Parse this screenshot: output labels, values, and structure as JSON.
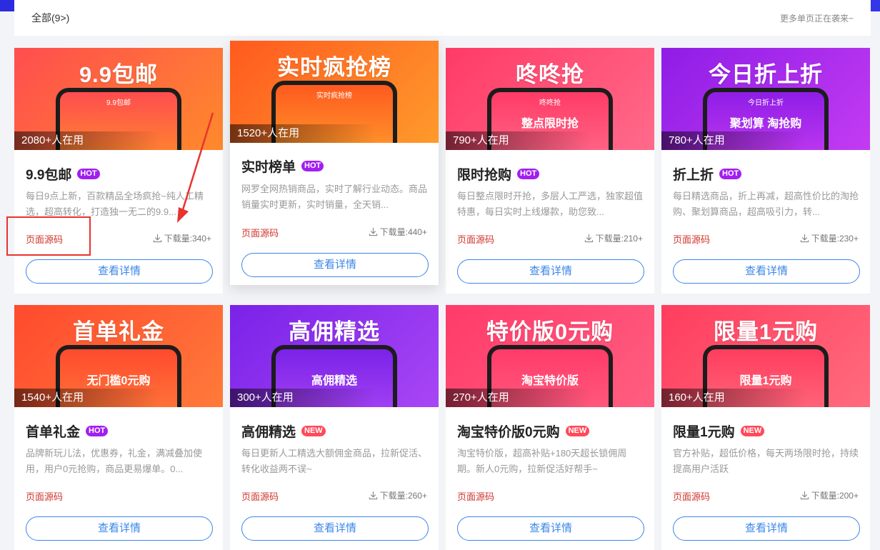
{
  "header": {
    "all_label": "全部(9>)",
    "more_label": "更多单页正在袭来~"
  },
  "common": {
    "source_label": "页面源码",
    "detail_label": "查看详情"
  },
  "cards": [
    {
      "banner_title": "9.9包邮",
      "phone_label": "9.9包邮",
      "phone_promo": "",
      "users": "2080+人在用",
      "title": "9.9包邮",
      "tag": "HOT",
      "desc": "每日9点上新，百款精品全场疯抢~纯人工精选，超高转化，打造独一无二的9.9...",
      "downloads": "下载量:340+",
      "bg": [
        "#ff4d4f",
        "#ff8a2b"
      ]
    },
    {
      "banner_title": "实时疯抢榜",
      "phone_label": "实时疯抢榜",
      "phone_promo": "",
      "users": "1520+人在用",
      "title": "实时榜单",
      "tag": "HOT",
      "desc": "网罗全网热销商品，实时了解行业动态。商品销量实时更新，实时销量，全天销...",
      "downloads": "下载量:440+",
      "bg": [
        "#ff5a1f",
        "#ff9a2b"
      ]
    },
    {
      "banner_title": "咚咚抢",
      "phone_label": "咚咚抢",
      "phone_promo": "整点限时抢",
      "users": "790+人在用",
      "title": "限时抢购",
      "tag": "HOT",
      "desc": "每日整点限时开抢，多层人工严选，独家超值特惠，每日实时上线爆款，助您致...",
      "downloads": "下载量:210+",
      "bg": [
        "#ff3b66",
        "#ff6a8a"
      ]
    },
    {
      "banner_title": "今日折上折",
      "phone_label": "今日折上折",
      "phone_promo": "聚划算 淘抢购",
      "users": "780+人在用",
      "title": "折上折",
      "tag": "HOT",
      "desc": "每日精选商品，折上再减，超高性价比的淘抢购、聚划算商品，超高吸引力，转...",
      "downloads": "下载量:230+",
      "bg": [
        "#8f1de6",
        "#c33bf2"
      ]
    },
    {
      "banner_title": "首单礼金",
      "phone_label": "",
      "phone_promo": "无门槛0元购",
      "users": "1540+人在用",
      "title": "首单礼金",
      "tag": "HOT",
      "desc": "品牌新玩儿法，优惠券，礼金，满减叠加使用，用户0元抢购，商品更易爆单。0...",
      "downloads": "",
      "bg": [
        "#ff4a2e",
        "#ff7a3a"
      ]
    },
    {
      "banner_title": "高佣精选",
      "phone_label": "",
      "phone_promo": "高佣精选",
      "users": "300+人在用",
      "title": "高佣精选",
      "tag": "NEW",
      "desc": "每日更新人工精选大额佣金商品，拉新促活、转化收益两不误~",
      "downloads": "下载量:260+",
      "bg": [
        "#7a22e8",
        "#a846f5"
      ]
    },
    {
      "banner_title": "特价版0元购",
      "phone_label": "",
      "phone_promo": "淘宝特价版",
      "users": "270+人在用",
      "title": "淘宝特价版0元购",
      "tag": "NEW",
      "desc": "淘宝特价版，超高补贴+180天超长锁佣周期。新人0元购，拉新促活好帮手~",
      "downloads": "",
      "bg": [
        "#ff3b6a",
        "#ff5e80"
      ]
    },
    {
      "banner_title": "限量1元购",
      "phone_label": "",
      "phone_promo": "限量1元购",
      "users": "160+人在用",
      "title": "限量1元购",
      "tag": "NEW",
      "desc": "官方补贴，超低价格，每天两场限时抢，持续提高用户活跃",
      "downloads": "下载量:200+",
      "bg": [
        "#ff3d5e",
        "#ff6b7e"
      ]
    }
  ],
  "colors": {
    "accent": "#3a86e8",
    "source": "#d0342c",
    "hot": "#a21ff0",
    "new": "#ff4a5a",
    "annotation": "#e8332f"
  }
}
